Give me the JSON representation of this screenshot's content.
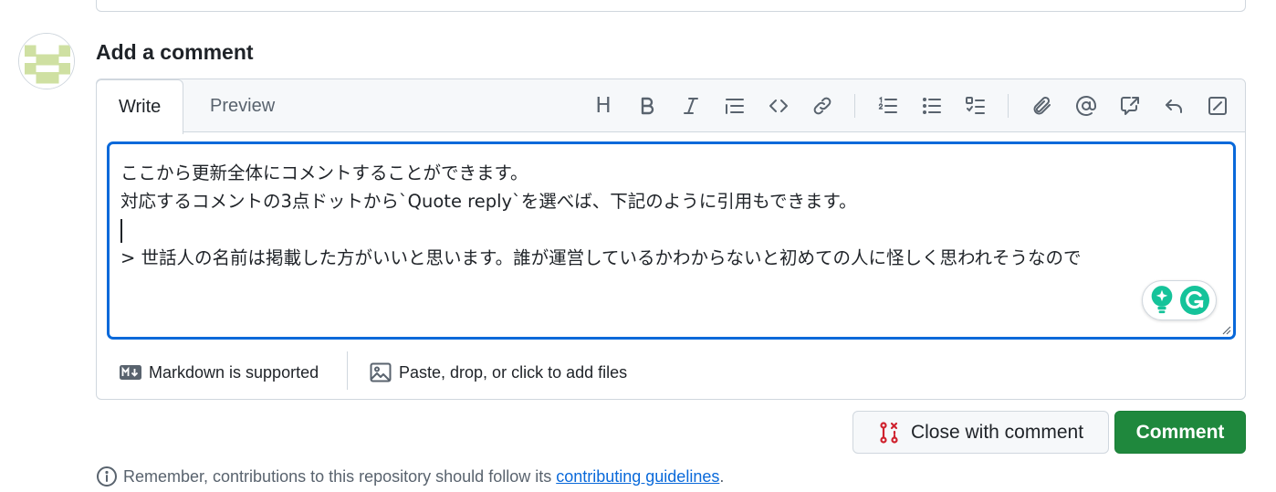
{
  "heading": "Add a comment",
  "tabs": {
    "write": "Write",
    "preview": "Preview"
  },
  "toolbar": {
    "heading": "heading-icon",
    "bold": "bold-icon",
    "italic": "italic-icon",
    "quote": "quote-icon",
    "code": "code-icon",
    "link": "link-icon",
    "ordered_list": "ordered-list-icon",
    "unordered_list": "unordered-list-icon",
    "task_list": "task-list-icon",
    "attach": "paperclip-icon",
    "mention": "mention-icon",
    "reference": "cross-reference-icon",
    "reply": "reply-icon",
    "fullscreen": "fullscreen-icon",
    "heading_label": "H"
  },
  "editor": {
    "line1": "ここから更新全体にコメントすることができます。",
    "line2": "対応するコメントの3点ドットから`Quote reply`を選べば、下記のように引用もできます。",
    "line3": "",
    "line4": "> 世話人の名前は掲載した方がいいと思います。誰が運営しているかわからないと初めての人に怪しく思われそうなので"
  },
  "footer": {
    "markdown": "Markdown is supported",
    "files": "Paste, drop, or click to add files"
  },
  "buttons": {
    "close": "Close with comment",
    "comment": "Comment"
  },
  "note": {
    "prefix": "Remember, contributions to this repository should follow its ",
    "link": "contributing guidelines",
    "suffix": "."
  },
  "colors": {
    "accent": "#0969da",
    "primary_button": "#1f883d",
    "close_icon": "#cf222e",
    "grammarly": "#15c39a"
  }
}
